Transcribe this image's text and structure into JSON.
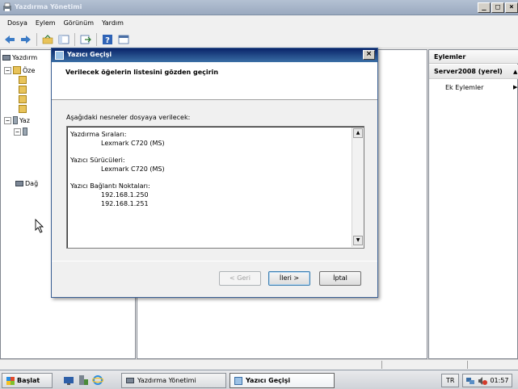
{
  "window": {
    "title": "Yazdırma Yönetimi"
  },
  "caption_buttons": {
    "minimize": "_",
    "maximize": "□",
    "close": "×"
  },
  "menu": [
    "Dosya",
    "Eylem",
    "Görünüm",
    "Yardım"
  ],
  "tree": {
    "root_label": "Yazdırm",
    "ozel_label": "Öze",
    "yaz_label": "Yaz",
    "dag_label": "Dağ",
    "expand_minus": "−"
  },
  "actions_pane": {
    "header": "Eylemler",
    "section": "Server2008 (yerel)",
    "section_arrow": "▲",
    "item": "Ek Eylemler",
    "item_arrow": "▶"
  },
  "dialog": {
    "title": "Yazıcı Geçişi",
    "close": "×",
    "heading": "Verilecek öğelerin listesini gözden geçirin",
    "intro": "Aşağıdaki nesneler dosyaya verilecek:",
    "list": {
      "queues_header": "Yazdırma Sıraları:",
      "queue_1": "Lexmark C720 (MS)",
      "drivers_header": "Yazıcı Sürücüleri:",
      "driver_1": "Lexmark C720 (MS)",
      "ports_header": "Yazıcı Bağlantı Noktaları:",
      "port_1": "192.168.1.250",
      "port_2": "192.168.1.251"
    },
    "scroll_up": "▲",
    "scroll_down": "▼",
    "back_button": "< Geri",
    "next_button": "İleri >",
    "cancel_button": "İptal"
  },
  "taskbar": {
    "start": "Başlat",
    "tasks": [
      "Yazdırma Yönetimi",
      "Yazıcı Geçişi"
    ],
    "language": "TR",
    "clock": "01:57"
  },
  "colors": {
    "title_active": "#0a246a",
    "title_inactive": "#9aa9bf",
    "pane_border": "#828790"
  }
}
